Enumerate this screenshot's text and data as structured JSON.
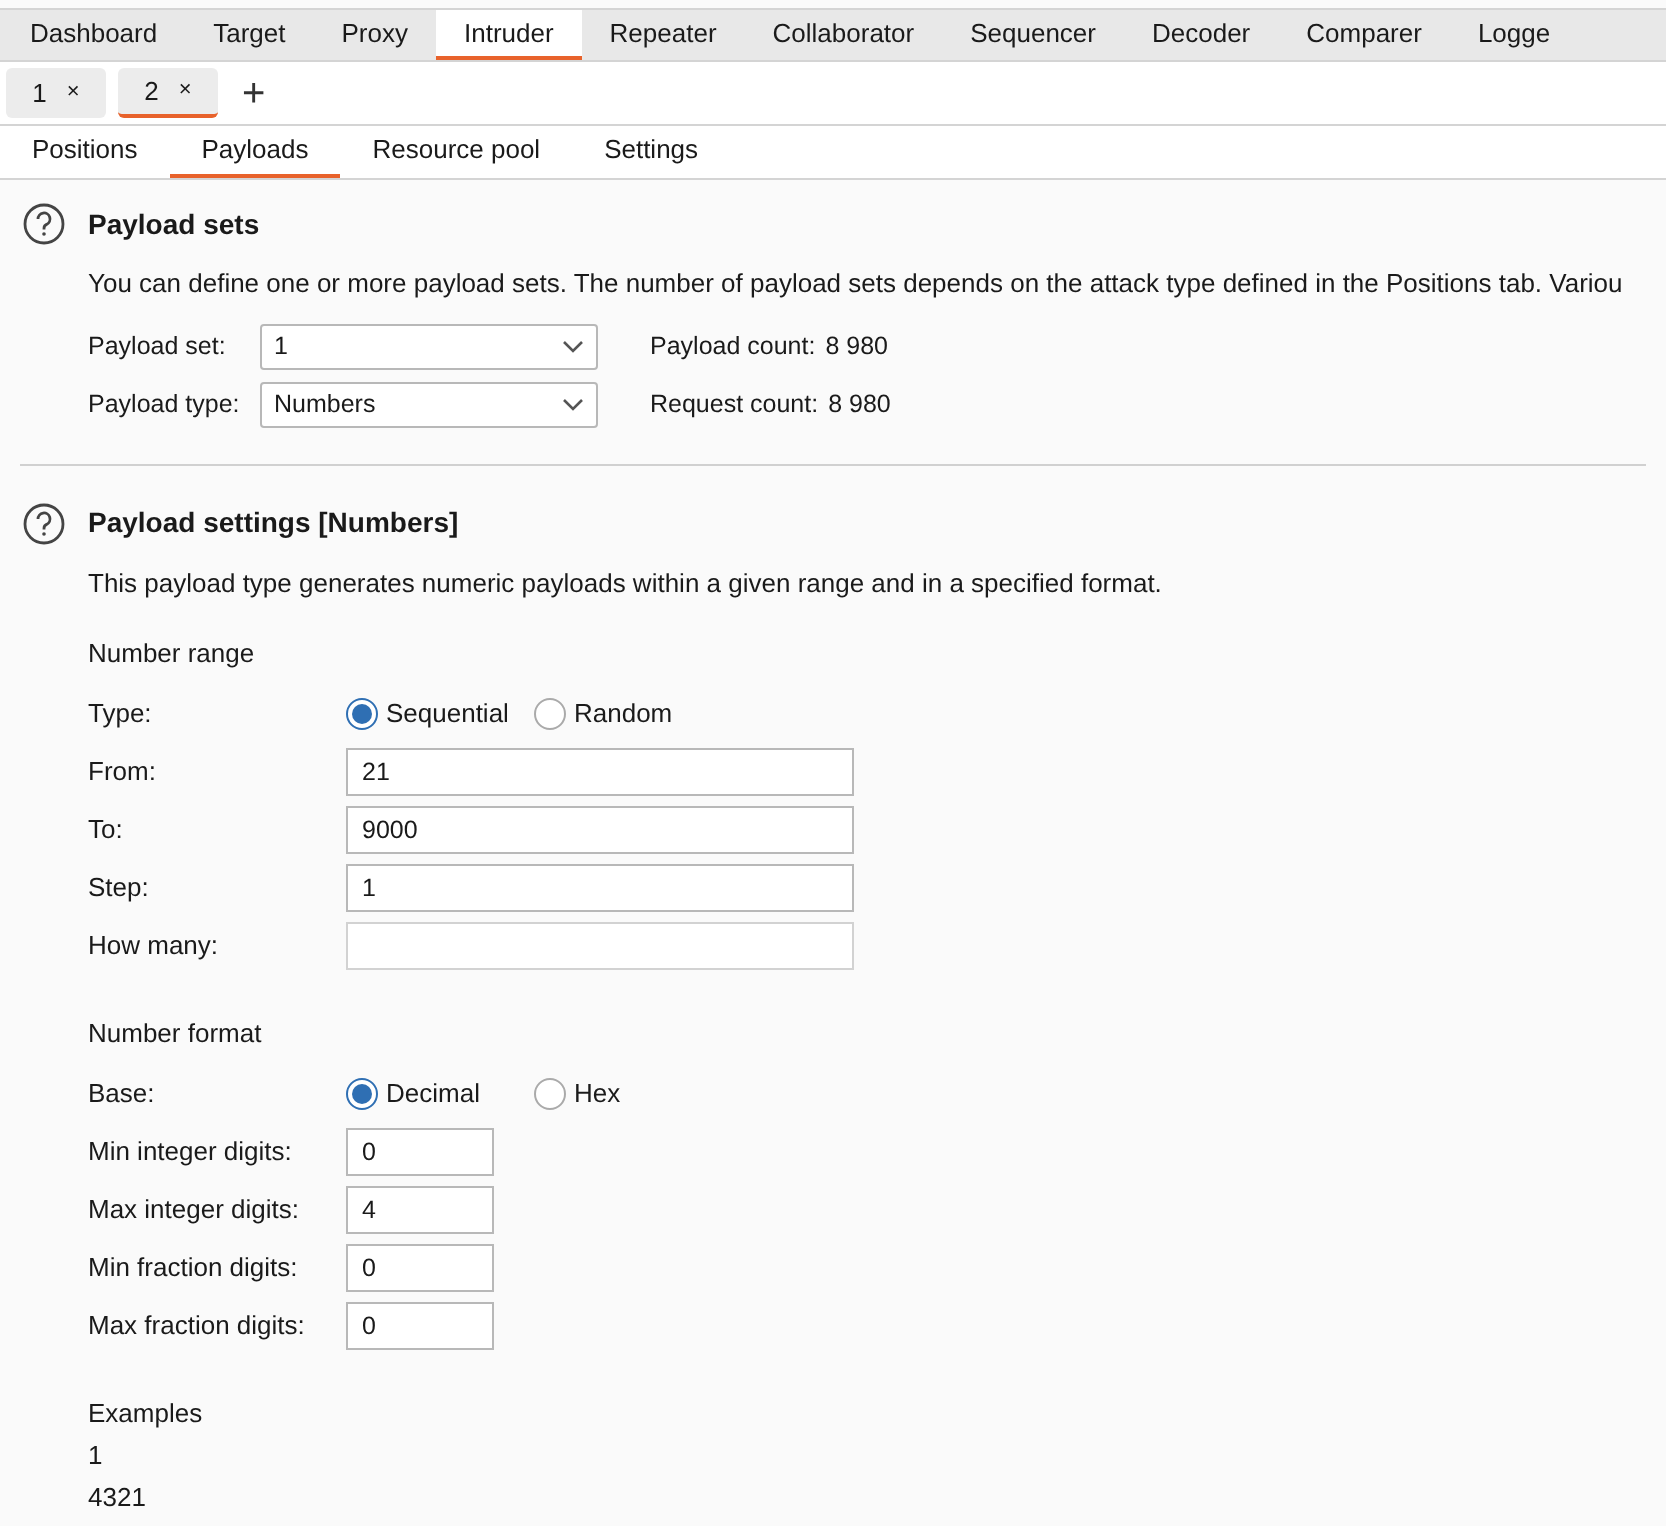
{
  "main_tabs": [
    {
      "label": "Dashboard",
      "selected": false
    },
    {
      "label": "Target",
      "selected": false
    },
    {
      "label": "Proxy",
      "selected": false
    },
    {
      "label": "Intruder",
      "selected": true
    },
    {
      "label": "Repeater",
      "selected": false
    },
    {
      "label": "Collaborator",
      "selected": false
    },
    {
      "label": "Sequencer",
      "selected": false
    },
    {
      "label": "Decoder",
      "selected": false
    },
    {
      "label": "Comparer",
      "selected": false
    },
    {
      "label": "Logge",
      "selected": false
    }
  ],
  "attack_tabs": [
    {
      "label": "1",
      "close": "×",
      "selected": false
    },
    {
      "label": "2",
      "close": "×",
      "selected": true
    }
  ],
  "add_tab": "+",
  "sub_tabs": [
    {
      "label": "Positions",
      "selected": false
    },
    {
      "label": "Payloads",
      "selected": true
    },
    {
      "label": "Resource pool",
      "selected": false
    },
    {
      "label": "Settings",
      "selected": false
    }
  ],
  "payload_sets": {
    "title": "Payload sets",
    "description": "You can define one or more payload sets. The number of payload sets depends on the attack type defined in the Positions tab. Variou",
    "dropdowns": [
      {
        "label": "Payload set:",
        "value": "1"
      },
      {
        "label": "Payload type:",
        "value": "Numbers"
      }
    ],
    "counts": [
      {
        "label": "Payload count:",
        "value": "8 980"
      },
      {
        "label": "Request count:",
        "value": "8 980"
      }
    ]
  },
  "payload_settings": {
    "title": "Payload settings [Numbers]",
    "description": "This payload type generates numeric payloads within a given range and in a specified format.",
    "groups": [
      {
        "heading": "Number range",
        "rows": [
          {
            "kind": "radio",
            "label": "Type:",
            "options": [
              {
                "label": "Sequential",
                "selected": true
              },
              {
                "label": "Random",
                "selected": false
              }
            ]
          },
          {
            "kind": "input",
            "label": "From:",
            "value": "21"
          },
          {
            "kind": "input",
            "label": "To:",
            "value": "9000"
          },
          {
            "kind": "input",
            "label": "Step:",
            "value": "1"
          },
          {
            "kind": "input",
            "label": "How many:"
          }
        ]
      },
      {
        "heading": "Number format",
        "rows": [
          {
            "kind": "radio",
            "label": "Base:",
            "options": [
              {
                "label": "Decimal",
                "selected": true
              },
              {
                "label": "Hex",
                "selected": false
              }
            ]
          },
          {
            "kind": "short_input",
            "label": "Min integer digits:",
            "value": "0"
          },
          {
            "kind": "short_input",
            "label": "Max integer digits:",
            "value": "4"
          },
          {
            "kind": "short_input",
            "label": "Min fraction digits:",
            "value": "0"
          },
          {
            "kind": "short_input",
            "label": "Max fraction digits:",
            "value": "0"
          }
        ]
      }
    ],
    "examples": {
      "heading": "Examples",
      "items": [
        "1",
        "4321"
      ]
    }
  }
}
